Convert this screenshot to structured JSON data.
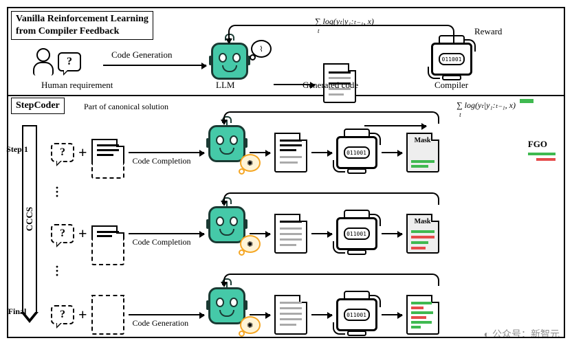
{
  "top": {
    "title_line1": "Vanilla Reinforcement Learning",
    "title_line2": "from Compiler Feedback",
    "human_label": "Human requirement",
    "arrow1": "Code Generation",
    "llm": "LLM",
    "gen_code": "Generated code",
    "compiler": "Compiler",
    "reward": "Reward",
    "formula": "∑ log(yₜ|y₁:ₜ₋₁, x)",
    "formula_sub": "t"
  },
  "bottom": {
    "title": "StepCoder",
    "part_label": "Part of canonical solution",
    "cccs": "CCCS",
    "steps": [
      {
        "name": "Step 1",
        "arrow": "Code Completion"
      },
      {
        "name": "",
        "arrow": "Code Completion"
      },
      {
        "name": "Final",
        "arrow": "Code Generation"
      }
    ],
    "fgo": "FGO",
    "mask": "Mask",
    "formula": "∑ log(yₜ|y₁:ₜ₋₁, x)",
    "formula_sub": "t"
  },
  "glyphs": {
    "question": "?",
    "spiral": "⌇",
    "bulb": "✺",
    "code": "011001"
  },
  "watermark": "公众号：新智元",
  "wm_icon": "◐"
}
